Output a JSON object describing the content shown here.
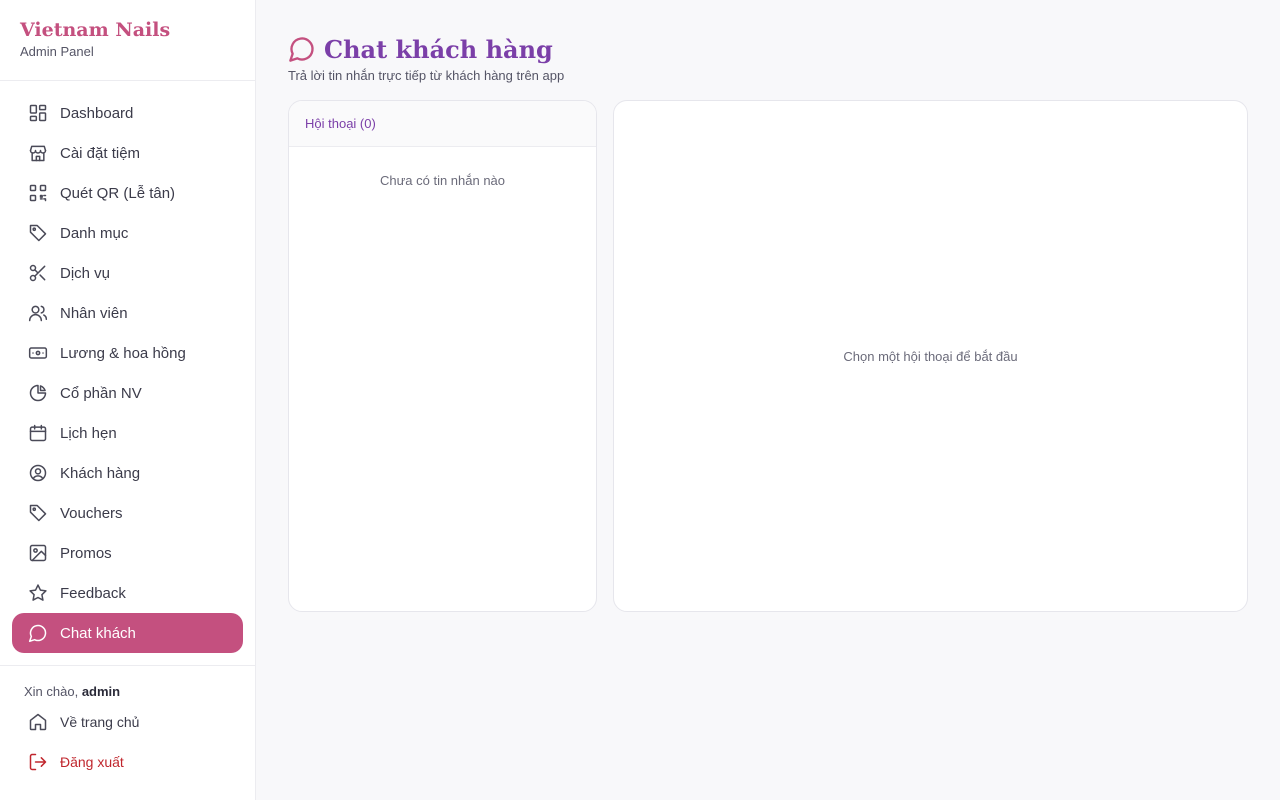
{
  "sidebar": {
    "brand_name": "Vietnam Nails",
    "brand_sub": "Admin Panel",
    "items": [
      {
        "label": "Dashboard",
        "icon": "dashboard-icon"
      },
      {
        "label": "Cài đặt tiệm",
        "icon": "store-icon"
      },
      {
        "label": "Quét QR (Lễ tân)",
        "icon": "qr-code-icon"
      },
      {
        "label": "Danh mục",
        "icon": "tag-icon"
      },
      {
        "label": "Dịch vụ",
        "icon": "scissors-icon"
      },
      {
        "label": "Nhân viên",
        "icon": "users-icon"
      },
      {
        "label": "Lương & hoa hồng",
        "icon": "banknote-icon"
      },
      {
        "label": "Cổ phần NV",
        "icon": "pie-chart-icon"
      },
      {
        "label": "Lịch hẹn",
        "icon": "calendar-icon"
      },
      {
        "label": "Khách hàng",
        "icon": "user-circle-icon"
      },
      {
        "label": "Vouchers",
        "icon": "tag-icon"
      },
      {
        "label": "Promos",
        "icon": "image-icon"
      },
      {
        "label": "Feedback",
        "icon": "star-icon"
      },
      {
        "label": "Chat khách",
        "icon": "chat-icon",
        "active": true
      }
    ],
    "greeting_prefix": "Xin chào, ",
    "username": "admin",
    "home_label": "Về trang chủ",
    "logout_label": "Đăng xuất"
  },
  "main": {
    "title": "Chat khách hàng",
    "subtitle": "Trả lời tin nhắn trực tiếp từ khách hàng trên app",
    "conversations_header": "Hội thoại (0)",
    "conversations_empty": "Chưa có tin nhắn nào",
    "chat_empty": "Chọn một hội thoại để bắt đầu"
  },
  "colors": {
    "brand": "#c4507f",
    "title": "#7b3fa8",
    "logout": "#c0262d"
  }
}
